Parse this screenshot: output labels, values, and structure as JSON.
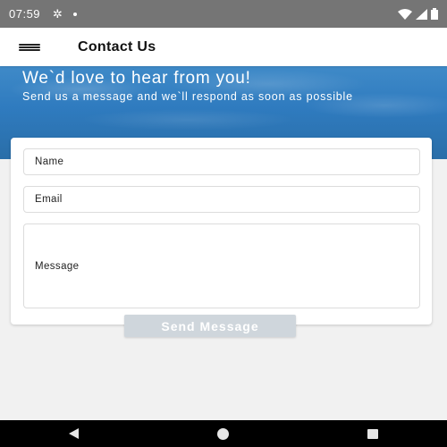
{
  "status_bar": {
    "time": "07:59",
    "icons": [
      "gear-icon",
      "notification-dot-icon",
      "wifi-icon",
      "signal-icon",
      "battery-icon"
    ]
  },
  "app_bar": {
    "title": "Contact Us",
    "menu_icon": "menu-icon"
  },
  "hero": {
    "title": "We`d love to hear from you!",
    "subtitle": "Send us a message and we`ll respond as soon as possible",
    "accent_color": "#2f7bbf"
  },
  "form": {
    "name_placeholder": "Name",
    "email_placeholder": "Email",
    "message_placeholder": "Message",
    "submit_label": "Send Message"
  },
  "nav_bar": {
    "icons": [
      "back-icon",
      "home-icon",
      "recent-apps-icon"
    ]
  }
}
